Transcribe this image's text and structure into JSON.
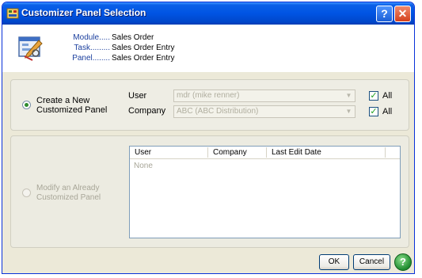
{
  "window": {
    "title": "Customizer Panel Selection",
    "help_glyph": "?",
    "close_glyph": "✕",
    "title_color": "#0054e3"
  },
  "header": {
    "module_label": "Module.....",
    "task_label": "Task.........",
    "panel_label": "Panel........",
    "module_value": "Sales Order",
    "task_value": "Sales Order Entry",
    "panel_value": "Sales Order Entry",
    "icon": "customizer-wrench-icon"
  },
  "create": {
    "option_label_line1": "Create a New",
    "option_label_line2": "Customized Panel",
    "user_label": "User",
    "company_label": "Company",
    "user_value": "mdr  (mike renner)",
    "company_value": "ABC  (ABC Distribution)",
    "all_user_label": "All",
    "all_company_label": "All",
    "selected": true,
    "all_user_checked": true,
    "all_company_checked": true
  },
  "modify": {
    "option_label_line1": "Modify an Already",
    "option_label_line2": "Customized Panel",
    "selected": false,
    "enabled": false,
    "columns": [
      "User",
      "Company",
      "Last Edit Date"
    ],
    "empty_text": "None"
  },
  "buttons": {
    "ok": "OK",
    "cancel": "Cancel",
    "help_icon": "help-circle-icon",
    "help_glyph": "?"
  }
}
